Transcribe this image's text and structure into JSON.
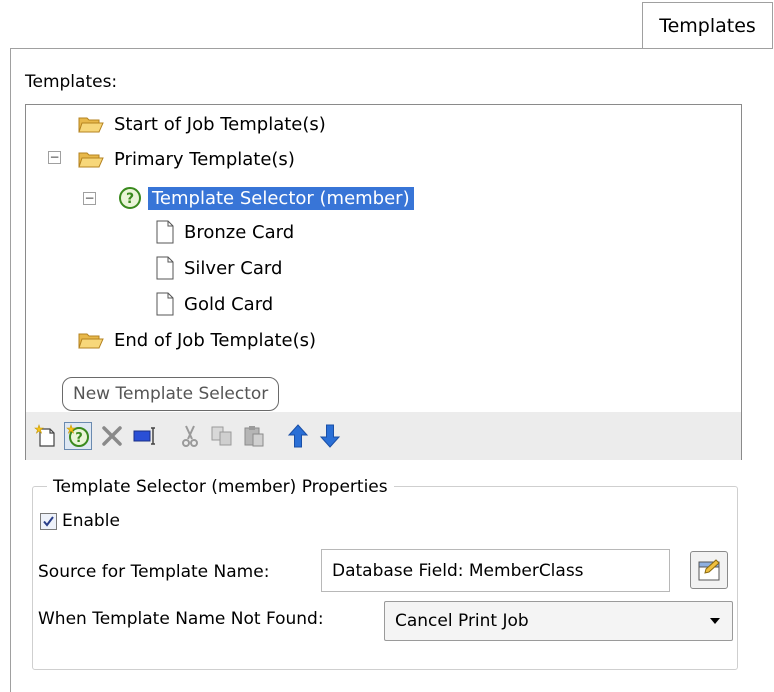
{
  "tab": {
    "label": "Templates"
  },
  "templates_label": "Templates:",
  "tree": {
    "start_of_job": "Start of Job Template(s)",
    "primary": "Primary Template(s)",
    "selector": "Template Selector (member)",
    "bronze": "Bronze Card",
    "silver": "Silver Card",
    "gold": "Gold Card",
    "end_of_job": "End of Job Template(s)",
    "expander_symbol": "−"
  },
  "tooltip": "New Template Selector",
  "toolbar": {
    "icons": [
      "new-template-icon",
      "new-template-selector-icon",
      "delete-icon",
      "rename-icon",
      "cut-icon",
      "copy-icon",
      "paste-icon",
      "move-up-icon",
      "move-down-icon"
    ]
  },
  "properties": {
    "title": "Template Selector (member) Properties",
    "enable_label": "Enable",
    "enable_checked": true,
    "source_label": "Source for Template Name:",
    "source_value": "Database Field: MemberClass",
    "notfound_label": "When Template Name Not Found:",
    "notfound_value": "Cancel Print Job"
  },
  "colors": {
    "selection": "#3875d7",
    "arrow_blue": "#2a6fd6"
  }
}
